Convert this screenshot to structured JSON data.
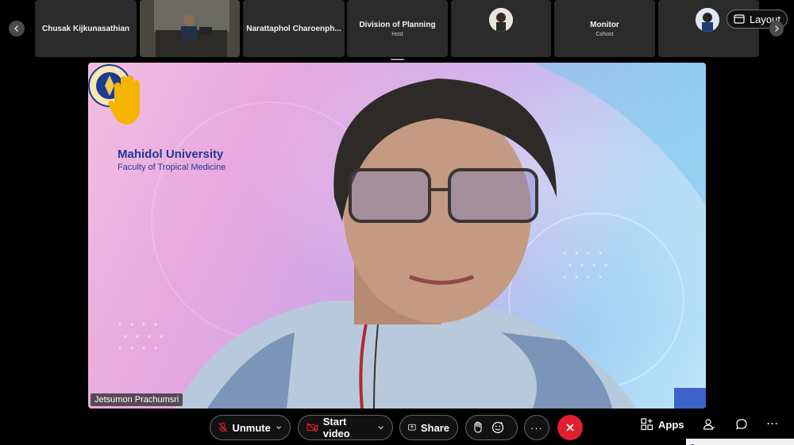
{
  "filmstrip": {
    "participants": [
      {
        "name": "Chusak Kijkunasathian",
        "role": ""
      },
      {
        "name": "",
        "role": ""
      },
      {
        "name": "Narattaphol Charoenph...",
        "role": ""
      },
      {
        "name": "Division of Planning",
        "role": "Host"
      },
      {
        "name": "",
        "role": ""
      },
      {
        "name": "Monitor",
        "role": "Cohost"
      },
      {
        "name": "",
        "role": ""
      }
    ],
    "layout_label": "Layout"
  },
  "video": {
    "speaker_name": "Jetsumon Prachumsri",
    "background_org": "Mahidol University",
    "background_faculty": "Faculty of Tropical Medicine",
    "reaction": "raised-hand"
  },
  "controls": {
    "unmute_label": "Unmute",
    "start_video_label": "Start video",
    "share_label": "Share",
    "apps_label": "Apps",
    "more_label": "···"
  },
  "colors": {
    "end_call": "#e0202f",
    "brand_text": "#1f3a93"
  }
}
